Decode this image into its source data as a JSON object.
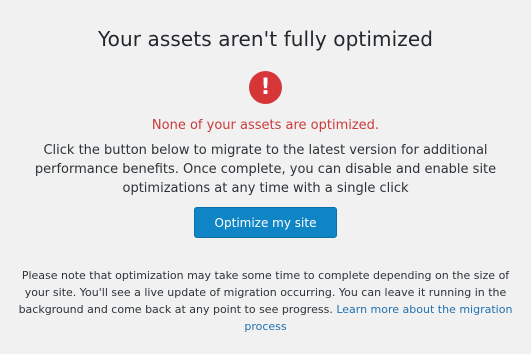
{
  "header": {
    "title": "Your assets aren't fully optimized"
  },
  "alert": {
    "icon": "exclamation-circle-icon",
    "glyph": "!",
    "color": "#d63638"
  },
  "status": {
    "text": "None of your assets are optimized."
  },
  "description": {
    "text": "Click the button below to migrate to the latest version for additional performance benefits. Once complete, you can disable and enable site optimizations at any time with a single click"
  },
  "actions": {
    "optimize_label": "Optimize my site"
  },
  "note": {
    "text": "Please note that optimization may take some time to complete depending on the size of your site. You'll see a live update of migration occurring. You can leave it running in the background and come back at any point to see progress. ",
    "link_text": "Learn more about the migration process"
  },
  "colors": {
    "accent": "#1085c6",
    "error": "#d63638",
    "link": "#2271b1"
  }
}
